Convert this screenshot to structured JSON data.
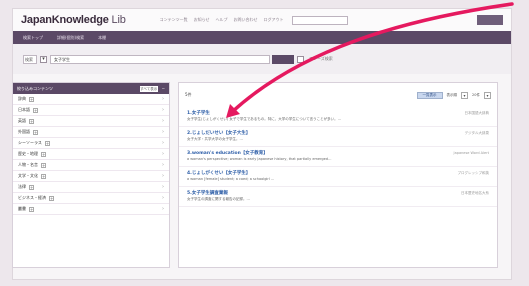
{
  "app": {
    "logo_main": "JapanKnowledge",
    "logo_sub": " Lib"
  },
  "header": {
    "links": [
      "コンテンツ一覧",
      "お知らせ",
      "ヘルプ",
      "お問い合わせ",
      "ログアウト"
    ],
    "search_value": "",
    "nav": [
      "検索トップ",
      "詳細(個別)検索",
      "本棚"
    ]
  },
  "search": {
    "field_select": "検索",
    "checkbox_mark": "▾",
    "query": "女子学生",
    "option_label": "フレーズ検索"
  },
  "facets": {
    "title": "絞り込みコンテンツ",
    "toggle_label": "すべて表示",
    "collapse_icon": "−",
    "items": [
      {
        "label": "辞典",
        "count": ""
      },
      {
        "label": "日本語",
        "count": ""
      },
      {
        "label": "英語",
        "count": ""
      },
      {
        "label": "外国語",
        "count": ""
      },
      {
        "label": "シーソーラス",
        "count": ""
      },
      {
        "label": "歴史・地理",
        "count": ""
      },
      {
        "label": "人物・名言",
        "count": ""
      },
      {
        "label": "文学・文化",
        "count": ""
      },
      {
        "label": "法律",
        "count": ""
      },
      {
        "label": "ビジネス・経済",
        "count": ""
      },
      {
        "label": "叢書",
        "count": ""
      }
    ]
  },
  "results": {
    "count_label": "5件",
    "view_label": "一覧表示",
    "sort_label": "表示順",
    "per_page_label": "20件",
    "items": [
      {
        "title": "1.女子学生",
        "source": "日本国語大辞典",
        "snippet": "女子学生(じょしがくせい) 女子で学生であるもの。特に、大学の学生について言うことが多い。…"
      },
      {
        "title": "2.じょしだいせい【女子大生】",
        "source": "デジタル大辞泉",
        "snippet": "女子大学・共学大学の女子学生。…"
      },
      {
        "title": "3.woman's education【女子教育】",
        "source": "Japanese Word Alert",
        "snippet": "a woman's perspective; woman is early Japanese history, that partially emerged…"
      },
      {
        "title": "4.じょしがくせい【女子学生】",
        "source": "プログレッシブ和英",
        "snippet": "a woman [female] student; a coed; a schoolgirl …"
      },
      {
        "title": "5.女子学生調査業報",
        "source": "日本歴史地名大系",
        "snippet": "女子学生の調査に関する報告の記録。…"
      }
    ]
  },
  "colors": {
    "nav": "#5b4966",
    "link": "#2d5ea8",
    "arrow": "#e5195f"
  }
}
